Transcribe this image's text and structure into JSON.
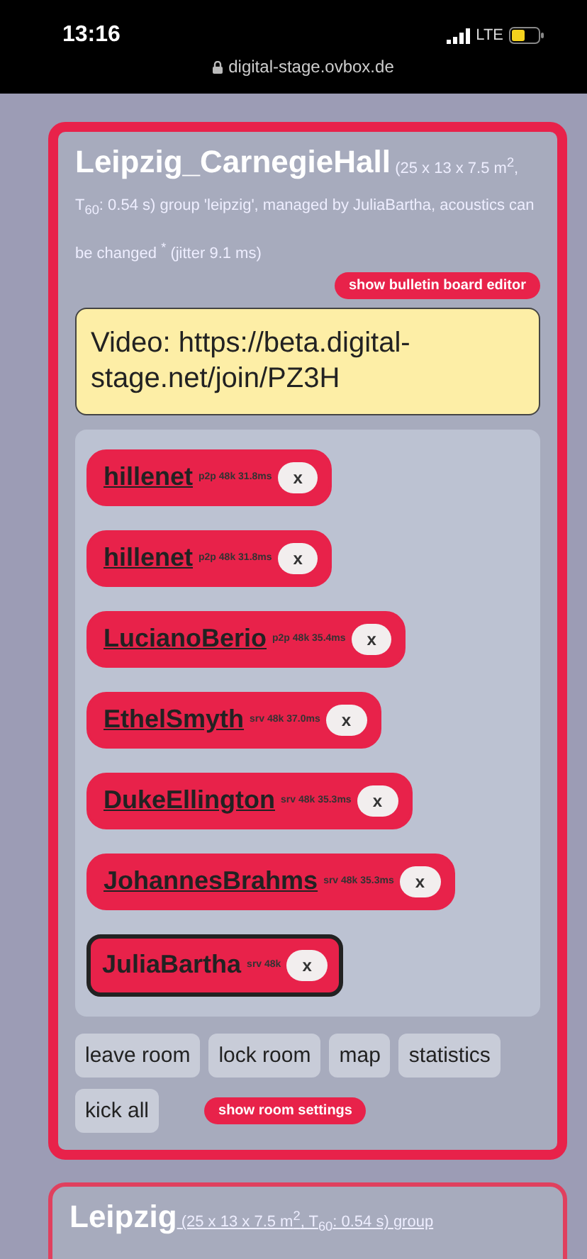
{
  "status_bar": {
    "time": "13:16",
    "network": "LTE",
    "url": "digital-stage.ovbox.de"
  },
  "rooms": [
    {
      "title": "Leipzig_CarnegieHall",
      "description": "(25 x 13 x 7.5 m$^{2}$, T$_{60}$: 0.54 s) group 'leipzig', managed by JuliaBartha, acoustics can be changed $^{*}$ (jitter 9.1 ms)",
      "active": true,
      "bulletin_button": "show bulletin board editor",
      "bulletin": "Video: https://beta.digital-stage.net/join/PZ3H",
      "members": [
        {
          "name": "hillenet",
          "info": "p2p 48k 31.8ms",
          "link": true,
          "self": false,
          "kick": "x"
        },
        {
          "name": "hillenet",
          "info": "p2p 48k 31.8ms",
          "link": true,
          "self": false,
          "kick": "x"
        },
        {
          "name": "LucianoBerio",
          "info": "p2p 48k 35.4ms",
          "link": true,
          "self": false,
          "kick": "x"
        },
        {
          "name": "EthelSmyth",
          "info": "srv 48k 37.0ms",
          "link": true,
          "self": false,
          "kick": "x"
        },
        {
          "name": "DukeEllington",
          "info": "srv 48k 35.3ms",
          "link": true,
          "self": false,
          "kick": "x"
        },
        {
          "name": "JohannesBrahms",
          "info": "srv 48k 35.3ms",
          "link": true,
          "self": false,
          "kick": "x"
        },
        {
          "name": "JuliaBartha",
          "info": "srv 48k",
          "link": false,
          "self": true,
          "kick": "x"
        }
      ],
      "buttons": [
        "leave room",
        "lock room",
        "map",
        "statistics",
        "kick all"
      ],
      "settings_button": "show room settings"
    },
    {
      "title": "Leipzig",
      "description": "(25 x 13 x 7.5 m$^{2}$, T$_{60}$: 0.54 s) group",
      "active": false
    }
  ]
}
